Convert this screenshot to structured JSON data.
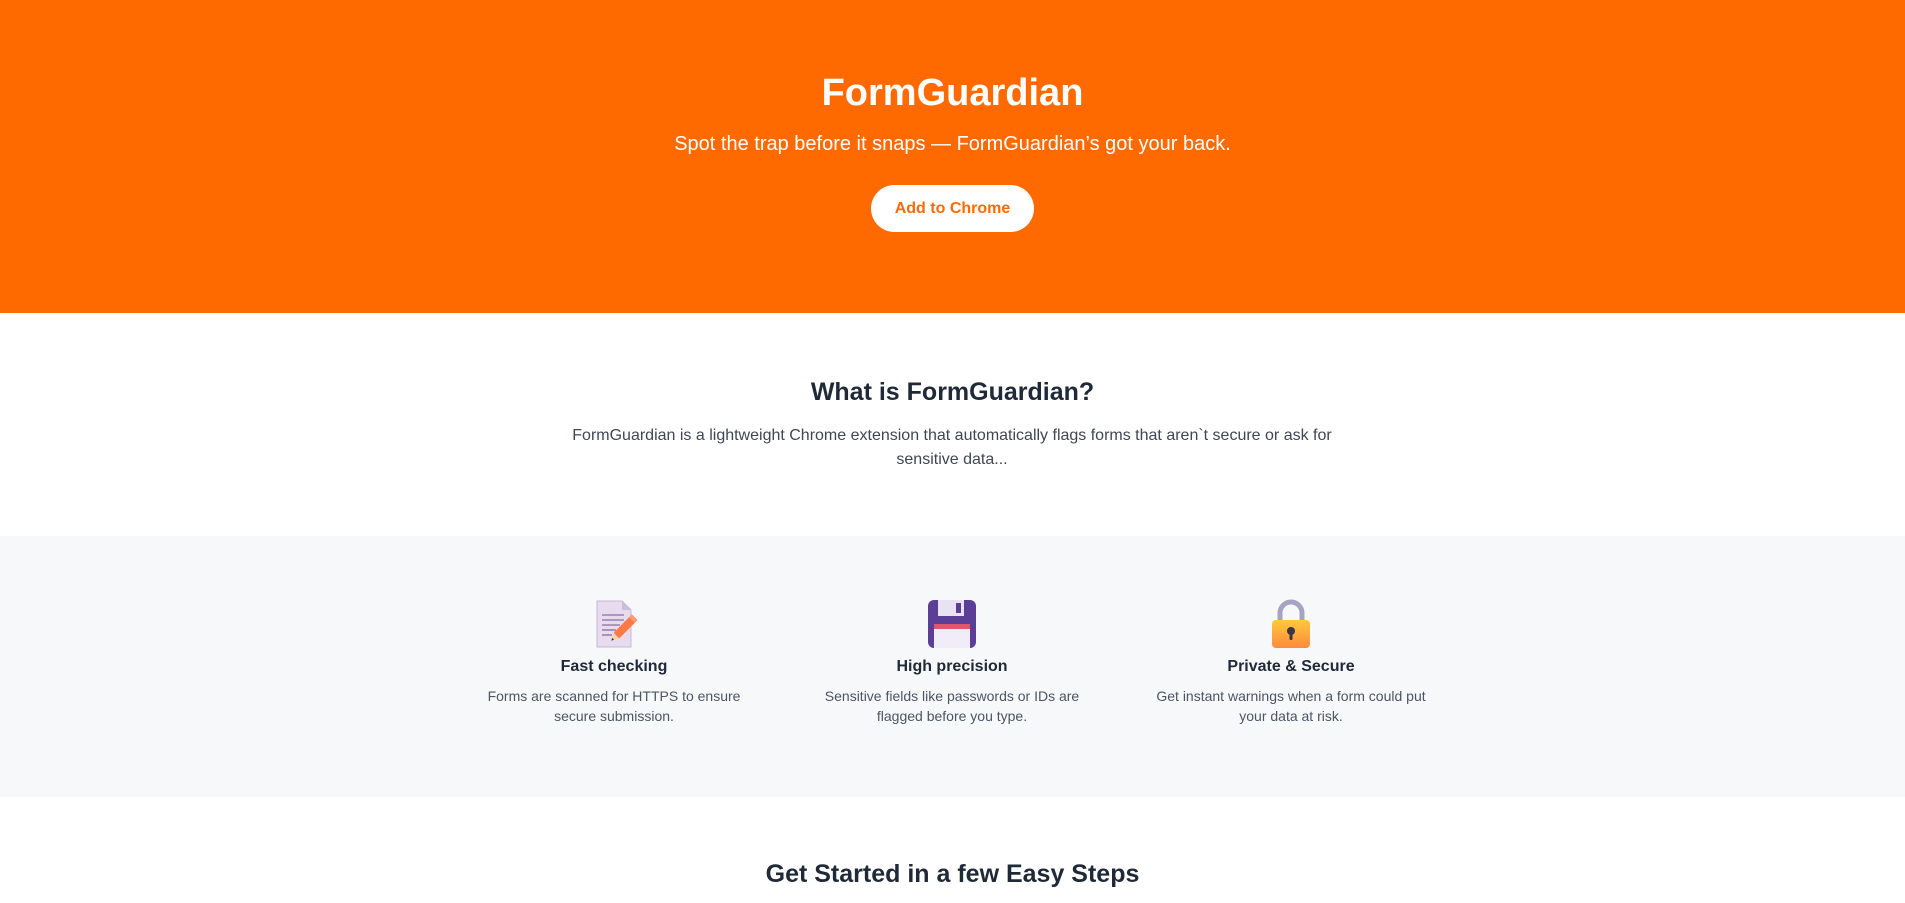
{
  "hero": {
    "title": "FormGuardian",
    "subtitle": "Spot the trap before it snaps — FormGuardian’s got your back.",
    "cta_label": "Add to Chrome",
    "background_color": "#ff6a00"
  },
  "about": {
    "title": "What is FormGuardian?",
    "text": "FormGuardian is a lightweight Chrome extension that automatically flags forms that aren`t secure or ask for sensitive data..."
  },
  "features": [
    {
      "icon": "memo-pencil-icon",
      "title": "Fast checking",
      "text": "Forms are scanned for HTTPS to ensure secure submission."
    },
    {
      "icon": "floppy-disk-icon",
      "title": "High precision",
      "text": "Sensitive fields like passwords or IDs are flagged before you type."
    },
    {
      "icon": "padlock-icon",
      "title": "Private & Secure",
      "text": "Get instant warnings when a form could put your data at risk."
    }
  ],
  "steps": {
    "title": "Get Started in a few Easy Steps"
  }
}
